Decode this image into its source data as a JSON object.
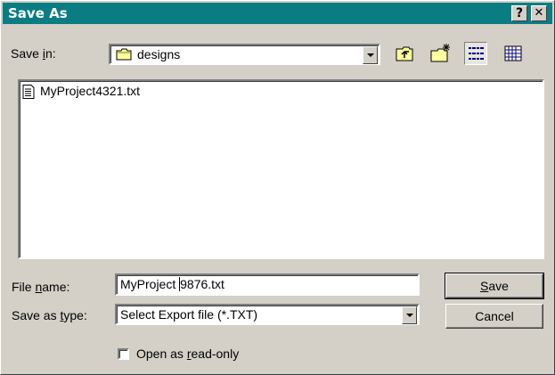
{
  "window": {
    "title": "Save As"
  },
  "titlebar": {
    "help_label": "?",
    "close_label": "✕"
  },
  "location": {
    "label_pre": "Save ",
    "label_u": "i",
    "label_post": "n:",
    "value": "designs"
  },
  "files": [
    {
      "name": "MyProject4321.txt"
    }
  ],
  "filename": {
    "label_pre": "File ",
    "label_u": "n",
    "label_post": "ame:",
    "value_before_cursor": "MyProject ",
    "value_after_cursor": "9876.txt"
  },
  "filetype": {
    "label_pre": "Save as ",
    "label_u": "t",
    "label_post": "ype:",
    "value": "Select Export file (*.TXT)"
  },
  "buttons": {
    "save_u": "S",
    "save_rest": "ave",
    "cancel": "Cancel"
  },
  "readonly": {
    "label_pre": "Open as ",
    "label_u": "r",
    "label_post": "ead-only",
    "checked": false
  },
  "icons": {
    "folder": "folder-icon",
    "up": "up-folder-icon",
    "new_folder": "new-folder-icon",
    "list_view": "list-view-icon",
    "details_view": "details-view-icon",
    "text_file": "text-file-icon"
  }
}
